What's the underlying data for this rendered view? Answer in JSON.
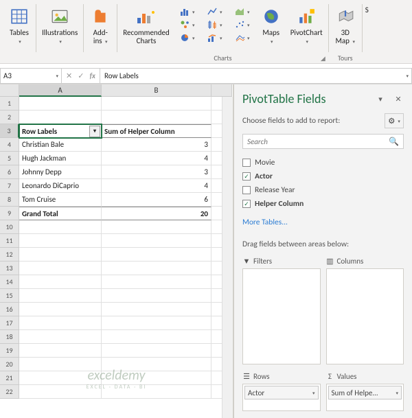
{
  "ribbon": {
    "tables": "Tables",
    "illustrations": "Illustrations",
    "addins": "Add-\nins",
    "recommended": "Recommended\nCharts",
    "maps": "Maps",
    "pivotchart": "PivotChart",
    "map3d": "3D\nMap",
    "sparkline_s": "S",
    "group_charts": "Charts",
    "group_tours": "Tours"
  },
  "namebox": "A3",
  "formula": "Row Labels",
  "columns": [
    "A",
    "B"
  ],
  "pivot_header": {
    "row_labels": "Row Labels",
    "values_label": "Sum of Helper Column"
  },
  "pivot_rows": [
    {
      "label": "Christian Bale",
      "value": "3"
    },
    {
      "label": "Hugh Jackman",
      "value": "4"
    },
    {
      "label": "Johnny Depp",
      "value": "3"
    },
    {
      "label": "Leonardo DiCaprio",
      "value": "4"
    },
    {
      "label": "Tom Cruise",
      "value": "6"
    }
  ],
  "grand_total": {
    "label": "Grand Total",
    "value": "20"
  },
  "pane": {
    "title": "PivotTable Fields",
    "subtitle": "Choose fields to add to report:",
    "search_placeholder": "Search",
    "fields": [
      {
        "name": "Movie",
        "checked": false
      },
      {
        "name": "Actor",
        "checked": true
      },
      {
        "name": "Release Year",
        "checked": false
      },
      {
        "name": "Helper Column",
        "checked": true
      }
    ],
    "more": "More Tables...",
    "areas_label": "Drag fields between areas below:",
    "filters": "Filters",
    "columns": "Columns",
    "rows": "Rows",
    "values": "Values",
    "rows_item": "Actor",
    "values_item": "Sum of Helpe..."
  },
  "watermark": {
    "line1": "exceldemy",
    "line2": "EXCEL · DATA · BI"
  }
}
